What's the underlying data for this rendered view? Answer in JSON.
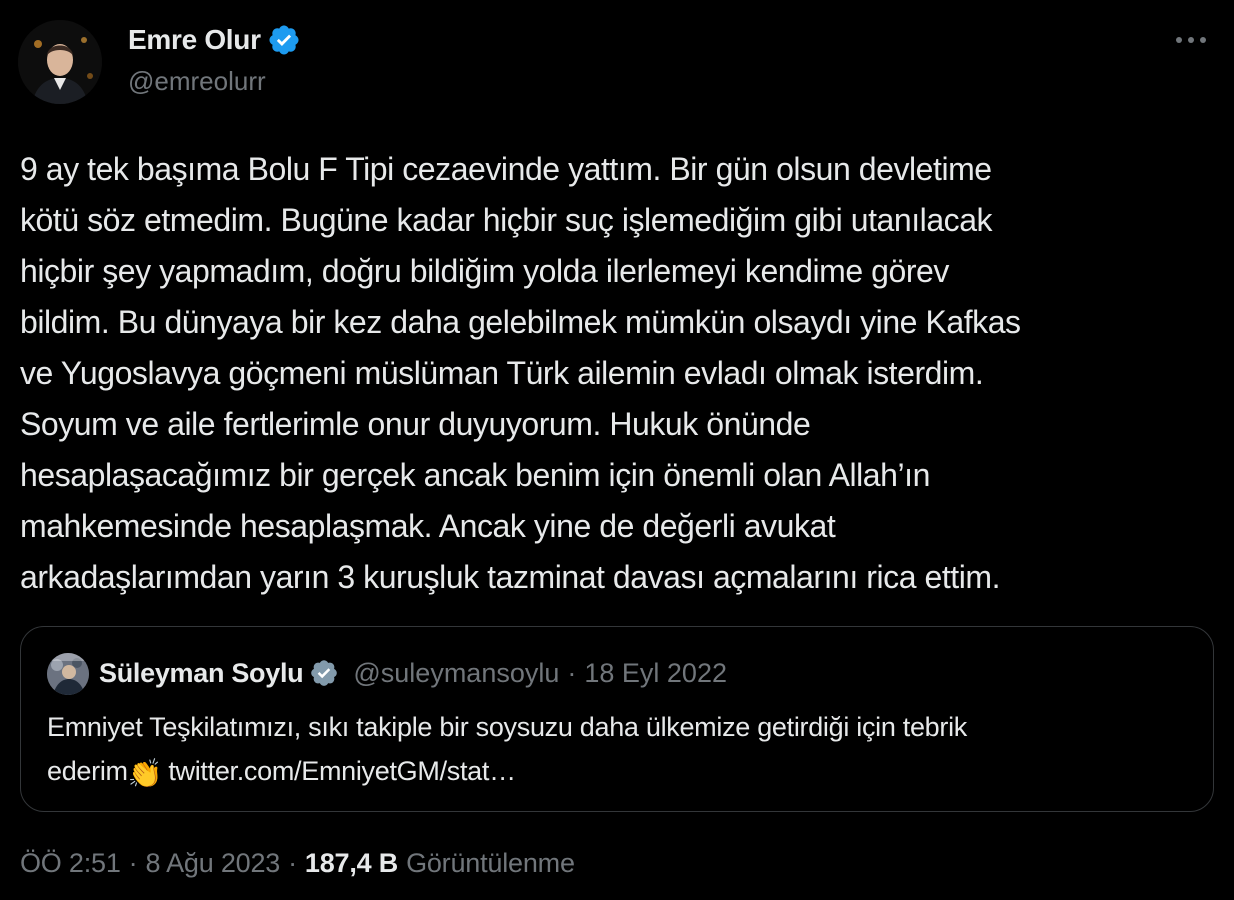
{
  "author": {
    "name": "Emre Olur",
    "handle": "@emreolurr",
    "verified": true,
    "avatar_icon": "person-avatar"
  },
  "tweet": {
    "text": "9 ay tek başıma Bolu F Tipi cezaevinde yattım. Bir gün olsun devletime\nkötü söz etmedim. Bugüne kadar hiçbir suç işlemediğim gibi utanılacak\nhiçbir şey yapmadım, doğru bildiğim yolda ilerlemeyi kendime görev\nbildim. Bu dünyaya bir kez daha gelebilmek mümkün olsaydı yine Kafkas\nve Yugoslavya göçmeni müslüman Türk ailemin evladı olmak isterdim.\nSoyum ve aile fertlerimle onur duyuyorum. Hukuk önünde\nhesaplaşacağımız bir gerçek ancak benim için önemli olan Allah’ın\nmahkemesinde hesaplaşmak. Ancak yine de değerli avukat\narkadaşlarımdan yarın 3 kuruşluk tazminat davası açmalarını rica ettim."
  },
  "quote": {
    "name": "Süleyman Soylu",
    "handle": "@suleymansoylu",
    "separator": "·",
    "date": "18 Eyl 2022",
    "verified": true,
    "text_line1": "Emniyet Teşkilatımızı, sıkı takiple bir soysuzu daha ülkemize getirdiği için tebrik",
    "text_prefix": "ederim",
    "emoji": "👏",
    "link": "twitter.com/EmniyetGM/stat…"
  },
  "meta": {
    "time": "ÖÖ 2:51",
    "separator": "·",
    "date": "8 Ağu 2023",
    "views_count": "187,4 B",
    "views_label": "Görüntülenme"
  },
  "colors": {
    "background": "#000000",
    "text_primary": "#e7e9ea",
    "text_secondary": "#71767b",
    "border": "#333639",
    "verified_badge": "#1d9bf0"
  }
}
